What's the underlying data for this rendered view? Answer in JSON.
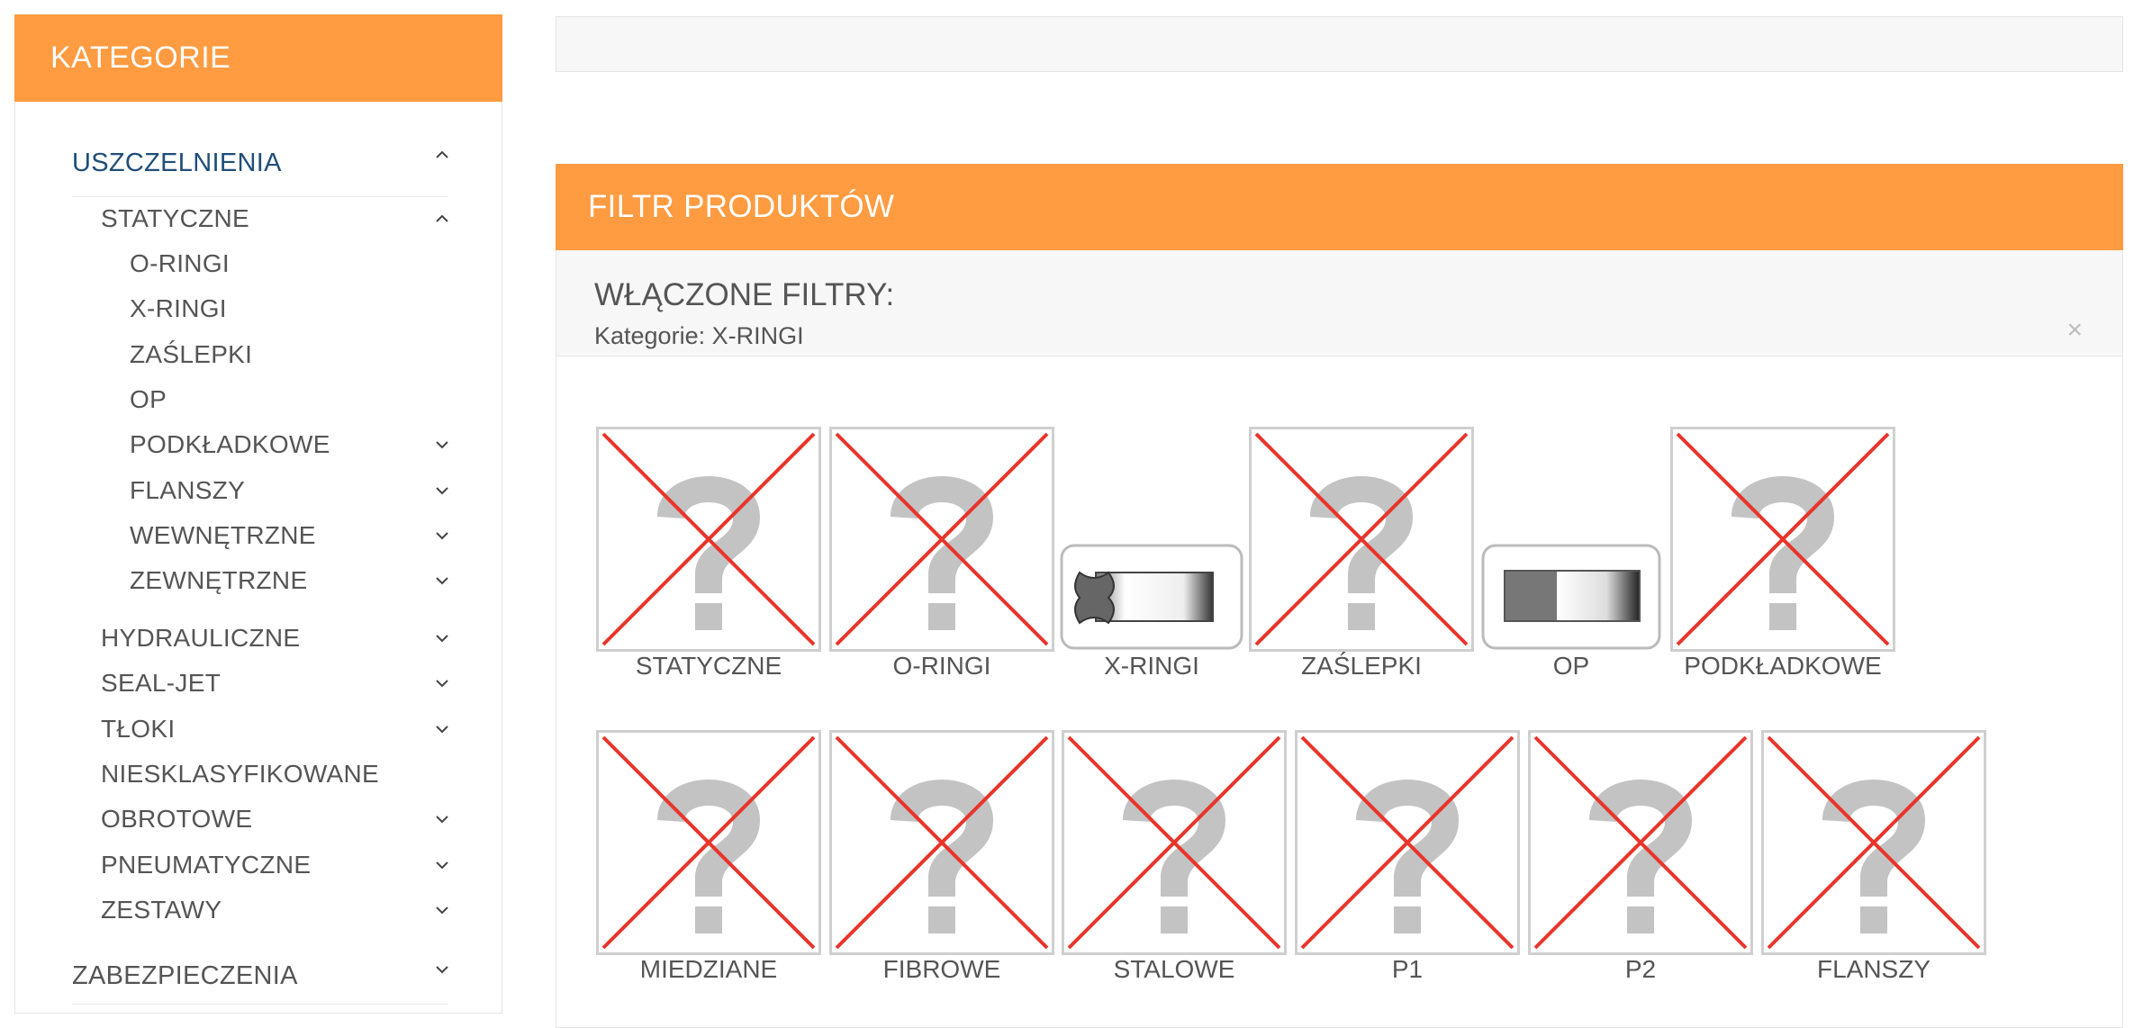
{
  "sidebar": {
    "title": "KATEGORIE",
    "top_category": "USZCZELNIENIA",
    "sub_category": "STATYCZNE",
    "statyczne_items": [
      {
        "label": "O-RINGI",
        "expandable": false
      },
      {
        "label": "X-RINGI",
        "expandable": false
      },
      {
        "label": "ZAŚLEPKI",
        "expandable": false
      },
      {
        "label": "OP",
        "expandable": false
      },
      {
        "label": "PODKŁADKOWE",
        "expandable": true
      },
      {
        "label": "FLANSZY",
        "expandable": true
      },
      {
        "label": "WEWNĘTRZNE",
        "expandable": true
      },
      {
        "label": "ZEWNĘTRZNE",
        "expandable": true
      }
    ],
    "siblings": [
      {
        "label": "HYDRAULICZNE",
        "expandable": true
      },
      {
        "label": "SEAL-JET",
        "expandable": true
      },
      {
        "label": "TŁOKI",
        "expandable": true
      },
      {
        "label": "NIESKLASYFIKOWANE",
        "expandable": false
      },
      {
        "label": "OBROTOWE",
        "expandable": true
      },
      {
        "label": "PNEUMATYCZNE",
        "expandable": true
      },
      {
        "label": "ZESTAWY",
        "expandable": true
      }
    ],
    "bottom_category": "ZABEZPIECZENIA"
  },
  "filter_panel": {
    "title": "FILTR PRODUKTÓW",
    "active_title": "WŁĄCZONE FILTRY:",
    "active_filter": "Kategorie: X-RINGI",
    "close": "×"
  },
  "products_row1": [
    {
      "label": "STATYCZNE",
      "image": "missing"
    },
    {
      "label": "O-RINGI",
      "image": "missing"
    },
    {
      "label": "X-RINGI",
      "image": "x-ring"
    },
    {
      "label": "ZAŚLEPKI",
      "image": "missing"
    },
    {
      "label": "OP",
      "image": "op"
    },
    {
      "label": "PODKŁADKOWE",
      "image": "missing"
    }
  ],
  "products_row2": [
    {
      "label": "MIEDZIANE",
      "image": "missing"
    },
    {
      "label": "FIBROWE",
      "image": "missing"
    },
    {
      "label": "STALOWE",
      "image": "missing"
    },
    {
      "label": "P1",
      "image": "missing"
    },
    {
      "label": "P2",
      "image": "missing"
    },
    {
      "label": "FLANSZY",
      "image": "missing"
    }
  ],
  "colors": {
    "accent": "#ff9b40",
    "link": "#1f4e79",
    "cross": "#e8352b"
  }
}
